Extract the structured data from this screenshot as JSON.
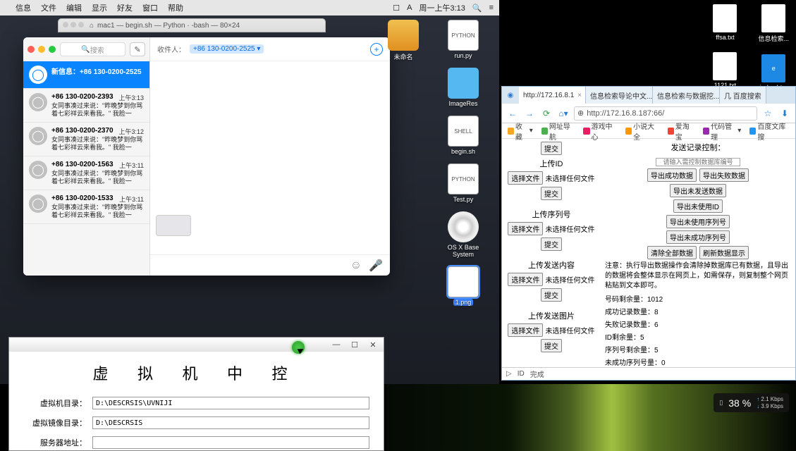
{
  "mac_menubar": {
    "items": [
      "信息",
      "文件",
      "编辑",
      "显示",
      "好友",
      "窗口",
      "帮助"
    ],
    "clock": "周一上午3:13"
  },
  "terminal": {
    "title": "mac1 — begin.sh — Python · -bash — 80×24"
  },
  "messages": {
    "search_placeholder": "搜索",
    "recipient_label": "收件人：",
    "recipient_pill": "+86 130-0200-2525",
    "conversations": [
      {
        "name": "新信息：+86 130-0200-2525",
        "time": "",
        "preview": "",
        "active": true
      },
      {
        "name": "+86 130-0200-2393",
        "time": "上午3:13",
        "preview": "女同事凑过来说：\"昨晚梦到你骂着七彩祥云来看我。\" 我脸一红：\"…"
      },
      {
        "name": "+86 130-0200-2370",
        "time": "上午3:12",
        "preview": "女同事凑过来说：\"昨晚梦到你骂着七彩祥云来看我。\" 我脸一红：\"…"
      },
      {
        "name": "+86 130-0200-1563",
        "time": "上午3:11",
        "preview": "女同事凑过来说：\"昨晚梦到你骂着七彩祥云来看我。\" 我脸一红：\"…"
      },
      {
        "name": "+86 130-0200-1533",
        "time": "上午3:11",
        "preview": "女同事凑过来说：\"昨晚梦到你骂着七彩祥云来看我。\" 我脸一红：\"…"
      }
    ]
  },
  "desktop_icons": [
    {
      "label": "run.py",
      "type": "file",
      "badge": "PYTHON"
    },
    {
      "label": "未命名",
      "type": "drive"
    },
    {
      "label": "ImageRes",
      "type": "folder"
    },
    {
      "label": "begin.sh",
      "type": "file",
      "badge": "SHELL"
    },
    {
      "label": "Test.py",
      "type": "file",
      "badge": "PYTHON"
    },
    {
      "label": "OS X Base System",
      "type": "disc"
    },
    {
      "label": "1.png",
      "type": "file",
      "selected": true
    }
  ],
  "win_icons": [
    {
      "label": "ffsa.txt"
    },
    {
      "label": "信息检索..."
    },
    {
      "label": "1121.txt"
    },
    {
      "label": "index.htm"
    }
  ],
  "browser": {
    "tabs": [
      {
        "label": "http://172.16.8.1",
        "active": true
      },
      {
        "label": "信息检索导论中文..."
      },
      {
        "label": "信息检索与数据挖..."
      },
      {
        "label": "几 百度搜索"
      }
    ],
    "url": "http://172.16.8.187:66/",
    "bookmarks": [
      "收藏",
      "网址导航",
      "游戏中心",
      "小说大全",
      "爱淘宝",
      "代码管理",
      "百度文库搜",
      "百度文库搜"
    ],
    "upload_sections": [
      {
        "title": "上传ID",
        "choose": "选择文件",
        "status": "未选择任何文件",
        "submit": "提交"
      },
      {
        "title": "上传序列号",
        "choose": "选择文件",
        "status": "未选择任何文件",
        "submit": "提交"
      },
      {
        "title": "上传发送内容",
        "choose": "选择文件",
        "status": "未选择任何文件",
        "submit": "提交"
      },
      {
        "title": "上传发送图片",
        "choose": "选择文件",
        "status": "未选择任何文件",
        "submit": "提交"
      }
    ],
    "top_submit": "提交",
    "record_ctrl_title": "发送记录控制：",
    "record_input_placeholder": "请输入需控制数据库编号",
    "export_buttons": [
      "导出成功数据",
      "导出失败数据",
      "导出未发送数据",
      "导出未使用ID",
      "导出未使用序列号",
      "导出未成功序列号",
      "清除全部数据",
      "刷新数据显示"
    ],
    "warning": "注意：执行导出数据操作会清除掉数据库已有数据，且导出的数据将会整体显示在网页上，如需保存，则复制整个网页粘贴到文本即可。",
    "stats": [
      "号码剩余量：1012",
      "成功记录数量：8",
      "失败记录数量：6",
      "ID剩余量：5",
      "序列号剩余量：5",
      "未成功序列号量：0"
    ],
    "status_bar": {
      "id_label": "ID",
      "done": "完成"
    }
  },
  "vm": {
    "title": "虚 拟 机 中 控",
    "rows": [
      {
        "label": "虚拟机目录：",
        "value": "D:\\DESCRSIS\\UVNIJI"
      },
      {
        "label": "虚拟镜像目录：",
        "value": "D:\\DESCRSIS"
      },
      {
        "label": "服务器地址：",
        "value": ""
      }
    ]
  },
  "net_widget": {
    "percent": "38 %",
    "up": "2.1 Kbps",
    "down": "3.9 Kbps"
  }
}
